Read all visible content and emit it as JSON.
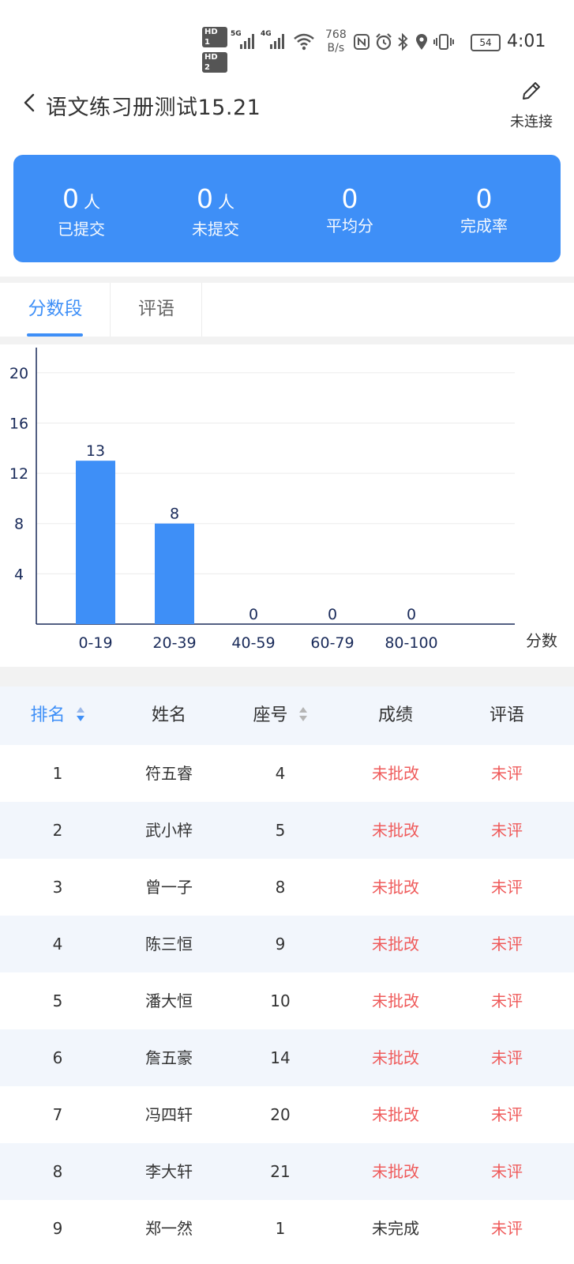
{
  "status_bar": {
    "hd1": "HD 1",
    "hd2": "HD 2",
    "signal1": "5G",
    "signal2": "4G",
    "net_speed_value": "768",
    "net_speed_unit": "B/s",
    "battery": "54",
    "time": "4:01"
  },
  "header": {
    "title": "语文练习册测试15.21",
    "edit_label": "未连接"
  },
  "stats": [
    {
      "value": "0",
      "unit": "人",
      "label": "已提交"
    },
    {
      "value": "0",
      "unit": "人",
      "label": "未提交"
    },
    {
      "value": "0",
      "unit": "",
      "label": "平均分"
    },
    {
      "value": "0",
      "unit": "",
      "label": "完成率"
    }
  ],
  "tabs": [
    {
      "label": "分数段",
      "active": true
    },
    {
      "label": "评语",
      "active": false
    }
  ],
  "chart_data": {
    "type": "bar",
    "categories": [
      "0-19",
      "20-39",
      "40-59",
      "60-79",
      "80-100"
    ],
    "values": [
      13,
      8,
      0,
      0,
      0
    ],
    "xlabel": "分数",
    "ylabel": "",
    "ylim": [
      0,
      22
    ],
    "yticks": [
      4,
      8,
      12,
      16,
      20
    ],
    "grid": true,
    "bar_color": "#3e8ff7",
    "label_color": "#1a2b5a"
  },
  "table": {
    "headers": [
      {
        "label": "排名",
        "sortable": true,
        "active": true
      },
      {
        "label": "姓名",
        "sortable": false,
        "active": false
      },
      {
        "label": "座号",
        "sortable": true,
        "active": false
      },
      {
        "label": "成绩",
        "sortable": false,
        "active": false
      },
      {
        "label": "评语",
        "sortable": false,
        "active": false
      }
    ],
    "rows": [
      {
        "rank": "1",
        "name": "符五睿",
        "seat": "4",
        "score": "未批改",
        "comment": "未评"
      },
      {
        "rank": "2",
        "name": "武小梓",
        "seat": "5",
        "score": "未批改",
        "comment": "未评"
      },
      {
        "rank": "3",
        "name": "曾一子",
        "seat": "8",
        "score": "未批改",
        "comment": "未评"
      },
      {
        "rank": "4",
        "name": "陈三恒",
        "seat": "9",
        "score": "未批改",
        "comment": "未评"
      },
      {
        "rank": "5",
        "name": "潘大恒",
        "seat": "10",
        "score": "未批改",
        "comment": "未评"
      },
      {
        "rank": "6",
        "name": "詹五豪",
        "seat": "14",
        "score": "未批改",
        "comment": "未评"
      },
      {
        "rank": "7",
        "name": "冯四轩",
        "seat": "20",
        "score": "未批改",
        "comment": "未评"
      },
      {
        "rank": "8",
        "name": "李大轩",
        "seat": "21",
        "score": "未批改",
        "comment": "未评"
      },
      {
        "rank": "9",
        "name": "郑一然",
        "seat": "1",
        "score": "未完成",
        "comment": "未评"
      }
    ]
  },
  "colors": {
    "accent": "#3e8ff7",
    "alert": "#ef5b5b",
    "row_alt": "#f2f6fc"
  }
}
